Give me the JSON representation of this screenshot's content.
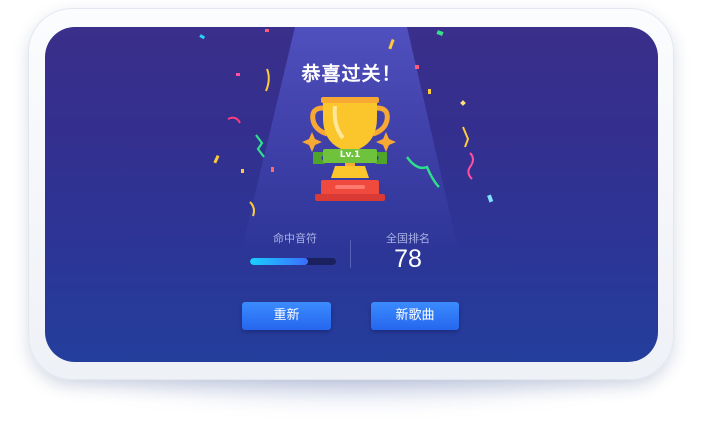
{
  "title": "恭喜过关！",
  "trophy": {
    "level_label": "Lv.1"
  },
  "stats": {
    "hit_notes_label": "命中音符",
    "hit_notes_progress": 0.67,
    "rank_label": "全国排名",
    "rank_value": "78"
  },
  "buttons": {
    "retry_label": "重新",
    "new_song_label": "新歌曲"
  },
  "colors": {
    "background": "#342f8e",
    "button": "#2d76f6",
    "progress": "#19d0ff",
    "trophy_gold": "#fbc52c",
    "ribbon_green": "#6fc23b",
    "pedestal_red": "#f0493d"
  }
}
